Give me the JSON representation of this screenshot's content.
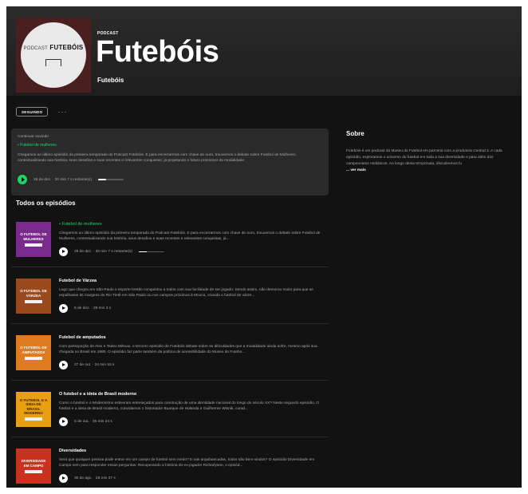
{
  "show": {
    "kind": "PODCAST",
    "title": "Futebóis",
    "publisher": "Futebóis",
    "cover_title": "FUTEBÓIS",
    "cover_prefix": "PODCAST"
  },
  "actions": {
    "follow_label": "SEGUINDO",
    "more_label": "···"
  },
  "continue_listening": {
    "label": "Continuar ouvindo",
    "episode": "Futebol de mulheres",
    "description": "Chegamos ao último episódio da primeira temporada do Podcast Futebóis. E para encerrarmos com chave de ouro, trouxemos o debate sobre Futebol de Mulheres, contextualizando sua história, seus desafios e suas recentes e relevantes conquistas, já projetando o futuro promissor da modalidade",
    "meta": "28 de dez. · 30 min 7 s restante(s)",
    "progress": 0.3
  },
  "episodes_title": "Todos os episódios",
  "episodes": [
    {
      "title": "Futebol de mulheres",
      "description": "Chegamos ao último episódio da primeira temporada do Podcast Futebóis. E para encerrarmos com chave de ouro, trouxemos o debate sobre Futebol de Mulheres, contextualizando sua história, seus desafios e suas recentes e relevantes conquistas, já...",
      "meta": "28 de dez. · 30 min 7 s restante(s)",
      "progress": 0.3,
      "thumb_text": "O FUTEBOL DE MULHERES",
      "thumb_bg": "#7a2a8c",
      "thumb_fg": "#ffffff"
    },
    {
      "title": "Futebol de Várzea",
      "description": "Logo que chegou em São Paulo o esporte bretão conquistou a todos com sua facilidade de ser jogado. Sendo assim, não demorou muito para que se espalhasse às margens do Rio Tietê em São Paulo ou nos campos próximos à Mooca, criando o futebol de várze...",
      "meta": "6 de dez. · 29 min 3 s",
      "thumb_text": "O FUTEBOL DE VÁRZEA",
      "thumb_bg": "#9a4a1c",
      "thumb_fg": "#ffffff"
    },
    {
      "title": "Futebol de amputados",
      "description": "Com participação de Alex e Tadeu Mitsuui, o terceiro episódio de Futebóis debate sobre as dificuldades que a modalidade ainda sofre, mesmo após sua chegada no Brasil em 1980. O episódio faz parte também da política de acessibilidade do Museu do Futebo...",
      "meta": "27 de out. · 24 min 53 s",
      "thumb_text": "O FUTEBOL DE AMPUTADOS",
      "thumb_bg": "#e07a1e",
      "thumb_fg": "#ffffff"
    },
    {
      "title": "O futebol e a ideia de Brasil moderno",
      "description": "Como o futebol e o Modernismo estiveram entrelaçados para construção de uma identidade nacional do longo do século XX? Neste segundo episódio, O futebol e a ideia de Brasil moderno, convidamos o historiador Buarque de Holanda e Guilherme Wisnik, curad...",
      "meta": "5 de out. · 35 min 24 s",
      "thumb_text": "O FUTEBOL E A IDEIA DE BRASIL MODERNO",
      "thumb_bg": "#e8a012",
      "thumb_fg": "#3a2400"
    },
    {
      "title": "Diversidades",
      "description": "Será que qualquer pessoa pode entrar em um campo de futebol sem medo? E nas arquibancadas, todos são bem-vindos? O episódio Diversidade em Campo vem para responder essas perguntas. Recuperando a história do ex-jogador Richarlyson, o episód...",
      "meta": "30 de ago. · 28 min 37 s",
      "thumb_text": "DIVERSIDADE EM CAMPO",
      "thumb_bg": "#c8321e",
      "thumb_fg": "#ffffff"
    }
  ],
  "about": {
    "title": "Sobre",
    "text": "Futebóis é um podcast do Museu do Futebol em parceria com a produtora Central 3. A cada episódio, exploramos o universo do futebol em toda a sua diversidade e para além dos campeonatos midiáticos. Ao longo desta temporada, discutiremos fu",
    "more": "... ver mais"
  },
  "colors": {
    "accent": "#1ed760",
    "background": "#121212",
    "panel": "#2a2a2a",
    "secondary_text": "#a7a7a7"
  }
}
